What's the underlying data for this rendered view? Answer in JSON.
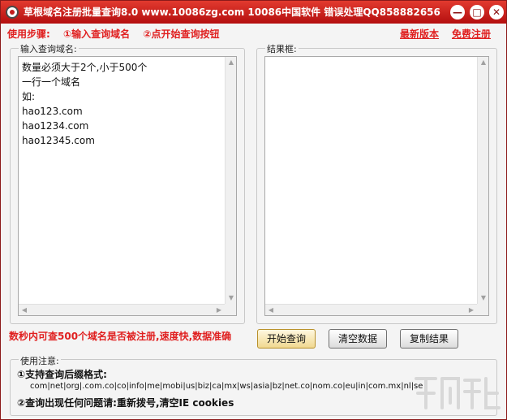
{
  "window": {
    "title": "草根域名注册批量查询8.0   www.10086zg.com  10086中国软件  错误处理QQ858882656",
    "minimize_glyph": "—",
    "maximize_glyph": "□",
    "close_glyph": "✕"
  },
  "steps": {
    "label": "使用步骤:",
    "step1": "①输入查询域名",
    "step2": "②点开始查询按钮"
  },
  "links": {
    "latest": "最新版本",
    "free_register": "免费注册"
  },
  "input_group": {
    "label": "输入查询域名:",
    "lines": [
      "数量必须大于2个,小于500个",
      "一行一个域名",
      "如:",
      "hao123.com",
      "hao1234.com",
      "hao12345.com"
    ]
  },
  "result_group": {
    "label": "结果框:"
  },
  "promo": "数秒内可查500个域名是否被注册,速度快,数据准确",
  "buttons": {
    "start": "开始查询",
    "clear": "清空数据",
    "copy": "复制结果"
  },
  "notes": {
    "title": "使用注意:",
    "note1": "①支持查询后缀格式:",
    "suffixes": "com|net|org|.com.co|co|info|me|mobi|us|biz|ca|mx|ws|asia|bz|net.co|nom.co|eu|in|com.mx|nl|se",
    "note2": "②查询出现任何问题请:重新拨号,清空IE cookies"
  },
  "icons": {
    "app": "app-logo-icon",
    "scroll_up": "▲",
    "scroll_down": "▼",
    "scroll_left": "◀",
    "scroll_right": "▶"
  },
  "colors": {
    "titlebar": "#c21b1b",
    "accent_red": "#e02020"
  }
}
